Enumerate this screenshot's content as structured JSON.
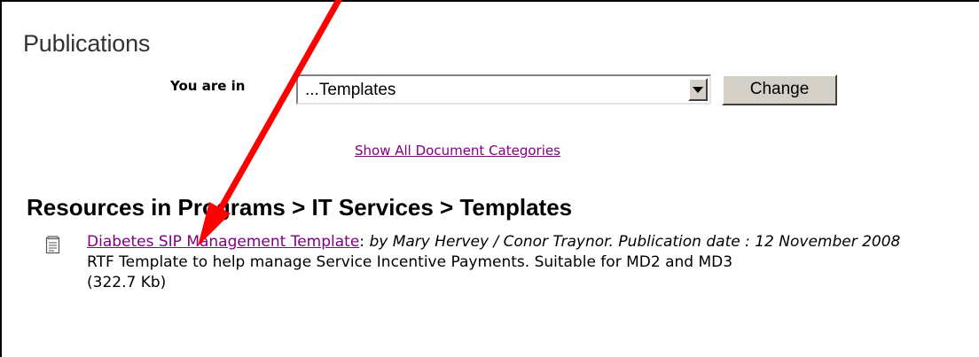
{
  "header": {
    "title": "Publications"
  },
  "category_selector": {
    "label": "You are in",
    "selected": "...Templates",
    "change_label": "Change"
  },
  "show_all_link": "Show All Document Categories",
  "resources": {
    "heading": "Resources in Programs > IT Services > Templates",
    "items": [
      {
        "title": "Diabetes SIP Management Template",
        "separator": ":",
        "meta": "by Mary Hervey / Conor Traynor. Publication date : 12 November 2008",
        "description": "RTF Template to help manage Service Incentive Payments. Suitable for MD2 and MD3",
        "size": "(322.7 Kb)"
      }
    ]
  },
  "annotation": {
    "arrow_color": "#ff0000"
  },
  "icons": {
    "document": "document-icon",
    "dropdown": "chevron-down-icon"
  }
}
